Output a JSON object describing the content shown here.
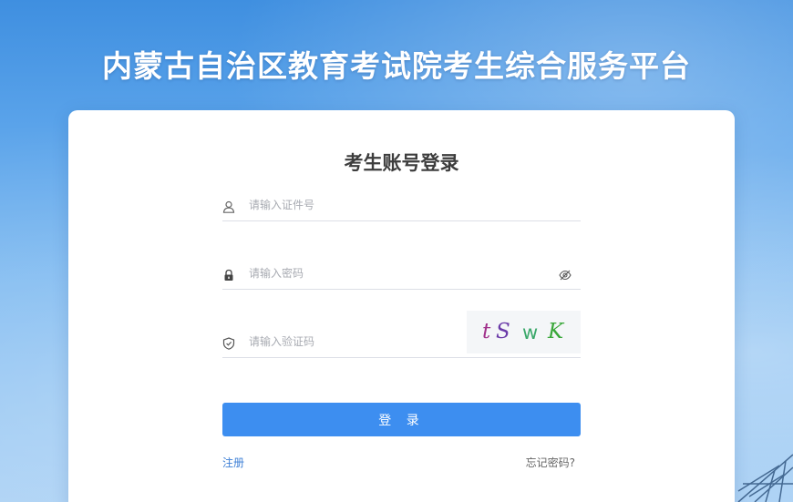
{
  "page": {
    "title": "内蒙古自治区教育考试院考生综合服务平台"
  },
  "login": {
    "title": "考生账号登录",
    "id_field": {
      "placeholder": "请输入证件号",
      "value": "",
      "icon": "user-icon"
    },
    "password_field": {
      "placeholder": "请输入密码",
      "value": "",
      "icon": "lock-icon",
      "toggle_icon": "eye-off-icon"
    },
    "captcha_field": {
      "placeholder": "请输入验证码",
      "value": "",
      "icon": "shield-icon"
    },
    "captcha": {
      "chars": [
        {
          "char": "t",
          "color": "#a0308a"
        },
        {
          "char": "S",
          "color": "#6a3aa8"
        },
        {
          "char": "w",
          "color": "#3aa86a"
        },
        {
          "char": "K",
          "color": "#3aa83a"
        }
      ]
    },
    "submit_label": "登 录",
    "register_label": "注册",
    "forgot_label": "忘记密码?"
  },
  "colors": {
    "primary": "#3d8ef0",
    "link": "#3d7fd6",
    "title": "#3d3d3d"
  }
}
